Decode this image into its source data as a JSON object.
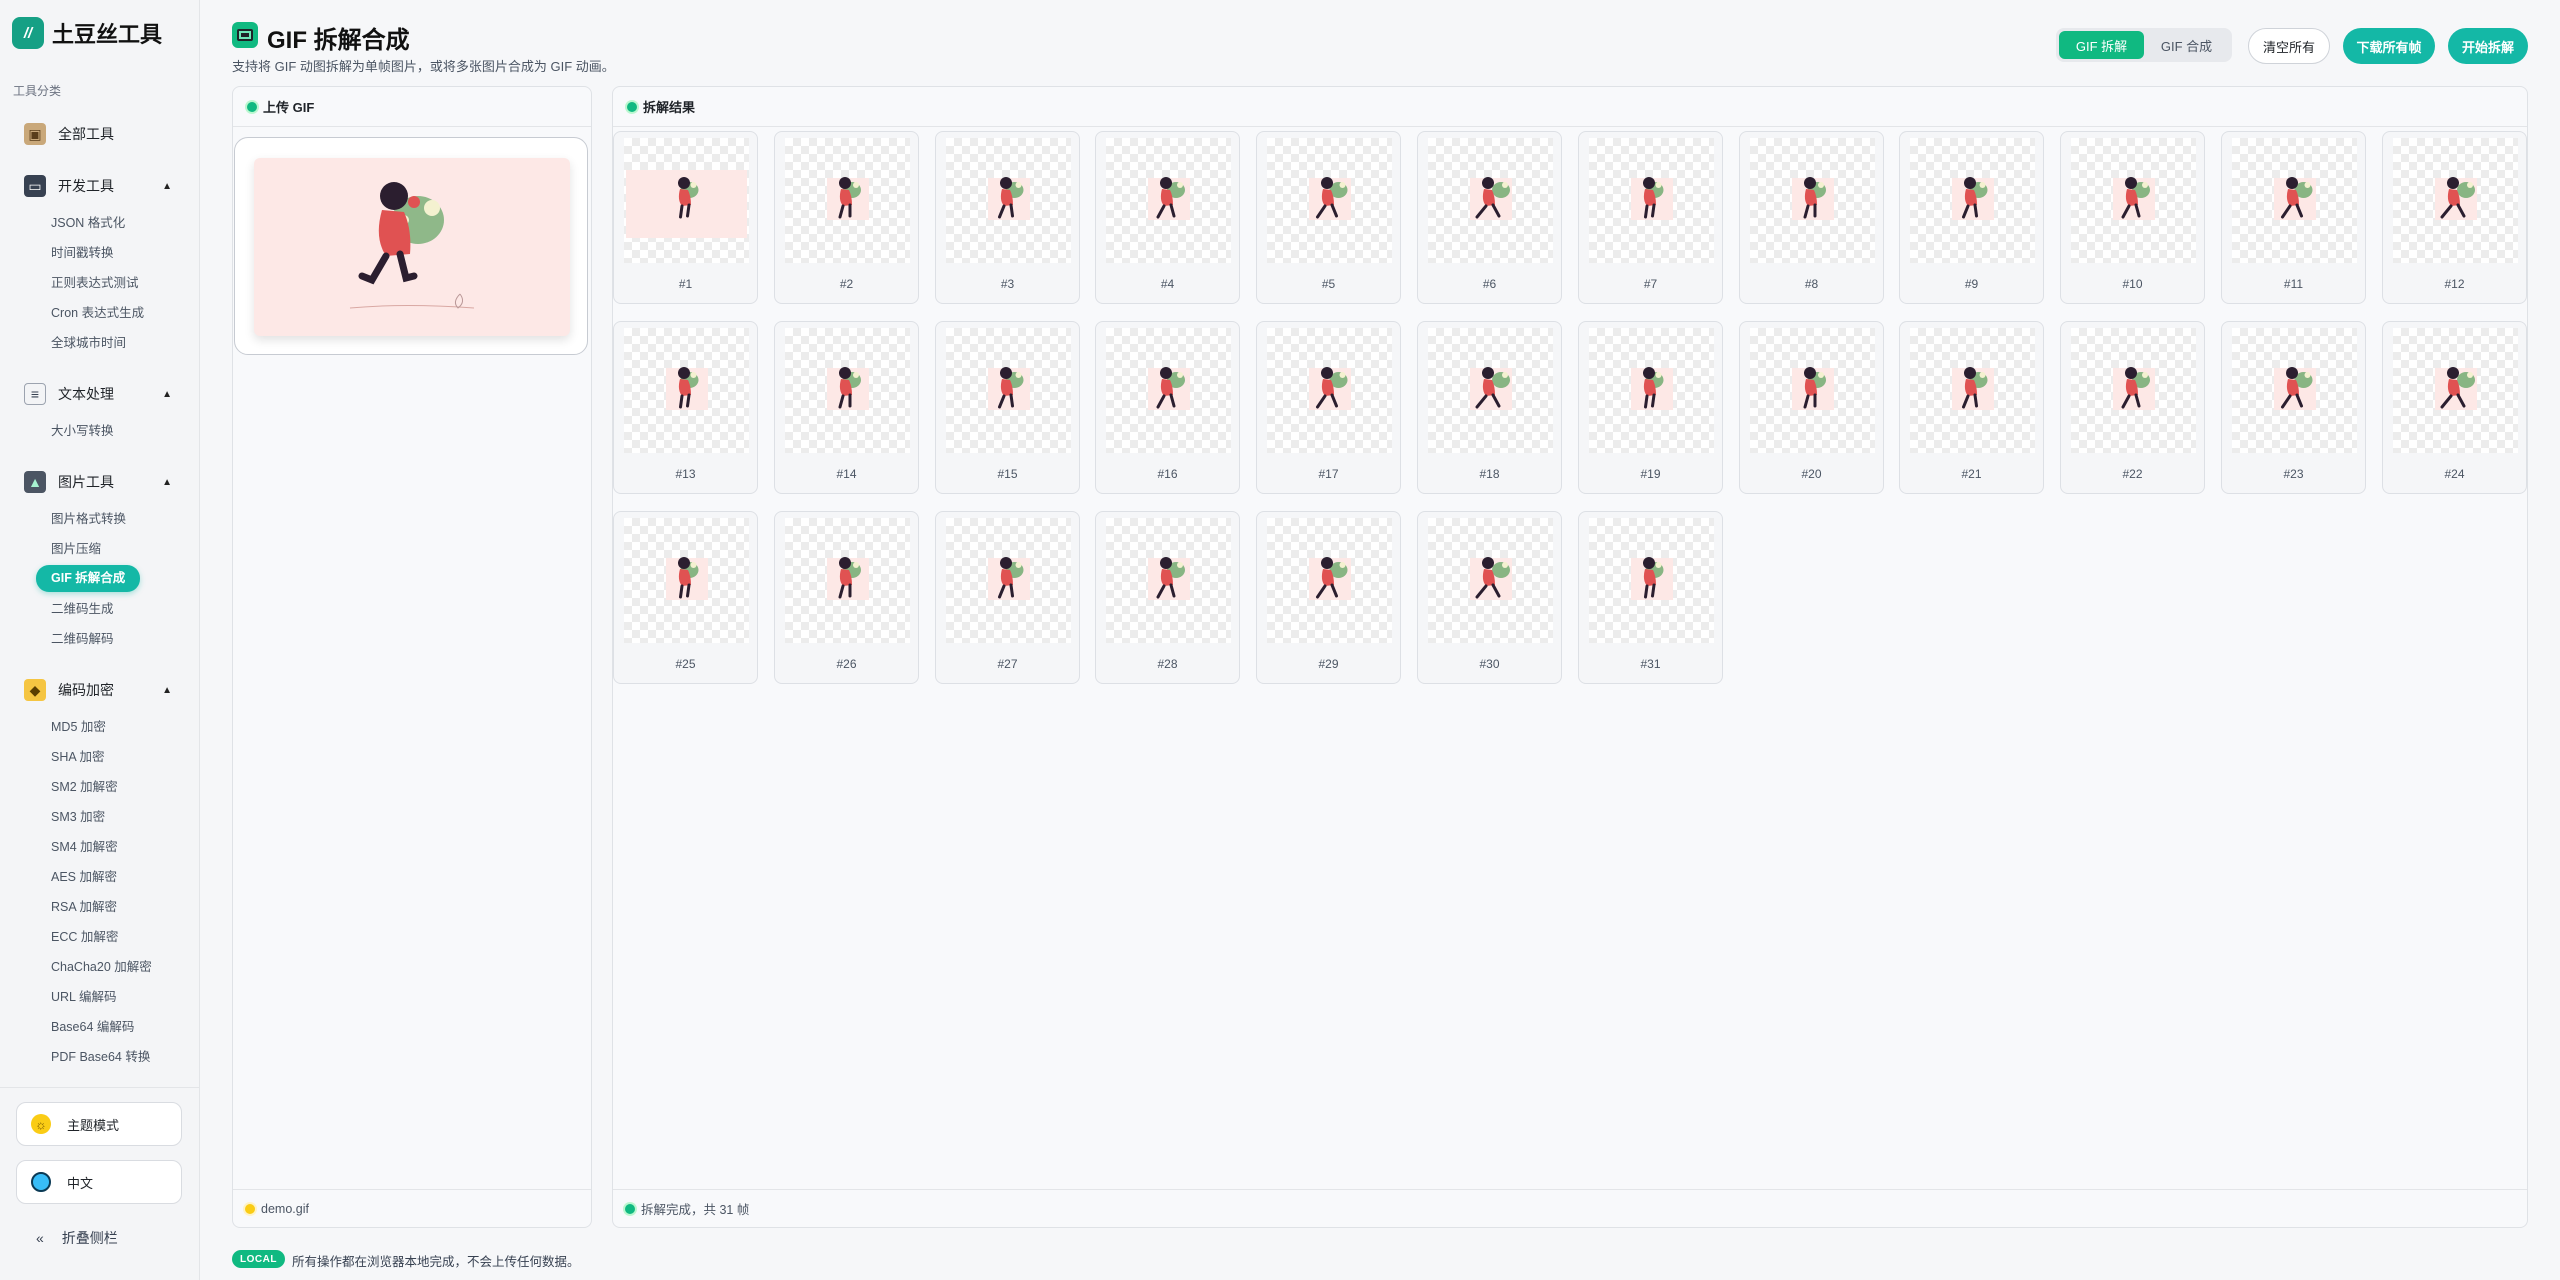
{
  "brand": {
    "name": "土豆丝工具",
    "logo_text": "//"
  },
  "sidebar": {
    "category_label": "工具分类",
    "groups": [
      {
        "label": "全部工具",
        "icon": "box-icon",
        "expandable": false,
        "items": []
      },
      {
        "label": "开发工具",
        "icon": "laptop-icon",
        "expandable": true,
        "items": [
          "JSON 格式化",
          "时间戳转换",
          "正则表达式测试",
          "Cron 表达式生成",
          "全球城市时间"
        ]
      },
      {
        "label": "文本处理",
        "icon": "document-icon",
        "expandable": true,
        "items": [
          "大小写转换"
        ]
      },
      {
        "label": "图片工具",
        "icon": "image-icon",
        "expandable": true,
        "items": [
          "图片格式转换",
          "图片压缩",
          "GIF 拆解合成",
          "二维码生成",
          "二维码解码"
        ]
      },
      {
        "label": "编码加密",
        "icon": "lock-icon",
        "expandable": true,
        "items": [
          "MD5 加密",
          "SHA 加密",
          "SM2 加解密",
          "SM3 加密",
          "SM4 加解密",
          "AES 加解密",
          "RSA 加解密",
          "ECC 加解密",
          "ChaCha20 加解密",
          "URL 编解码",
          "Base64 编解码",
          "PDF Base64 转换"
        ]
      }
    ],
    "active_item": "GIF 拆解合成",
    "theme_label": "主题模式",
    "language_label": "中文",
    "collapse_label": "折叠侧栏",
    "collapse_glyph": "«"
  },
  "header": {
    "title": "GIF 拆解合成",
    "subtitle": "支持将 GIF 动图拆解为单帧图片，或将多张图片合成为 GIF 动画。",
    "modes": [
      "GIF 拆解",
      "GIF 合成"
    ],
    "active_mode": "GIF 拆解",
    "clear_label": "清空所有",
    "download_label": "下载所有帧",
    "start_label": "开始拆解"
  },
  "upload_panel": {
    "title": "上传 GIF",
    "file_name": "demo.gif"
  },
  "result_panel": {
    "title": "拆解结果",
    "status": "拆解完成，共 31 帧",
    "frame_count": 31,
    "frame_labels": [
      "#1",
      "#2",
      "#3",
      "#4",
      "#5",
      "#6",
      "#7",
      "#8",
      "#9",
      "#10",
      "#11",
      "#12",
      "#13",
      "#14",
      "#15",
      "#16",
      "#17",
      "#18",
      "#19",
      "#20",
      "#21",
      "#22",
      "#23",
      "#24",
      "#25",
      "#26",
      "#27",
      "#28",
      "#29",
      "#30",
      "#31"
    ]
  },
  "footer": {
    "badge": "LOCAL",
    "note": "所有操作都在浏览器本地完成，不会上传任何数据。"
  },
  "colors": {
    "accent": "#14b8a6",
    "accent_green": "#10b981",
    "preview_bg": "#fde8e6",
    "figure_red": "#e05252",
    "figure_dark": "#2b1e2f",
    "leaf_green": "#6aa86a"
  }
}
